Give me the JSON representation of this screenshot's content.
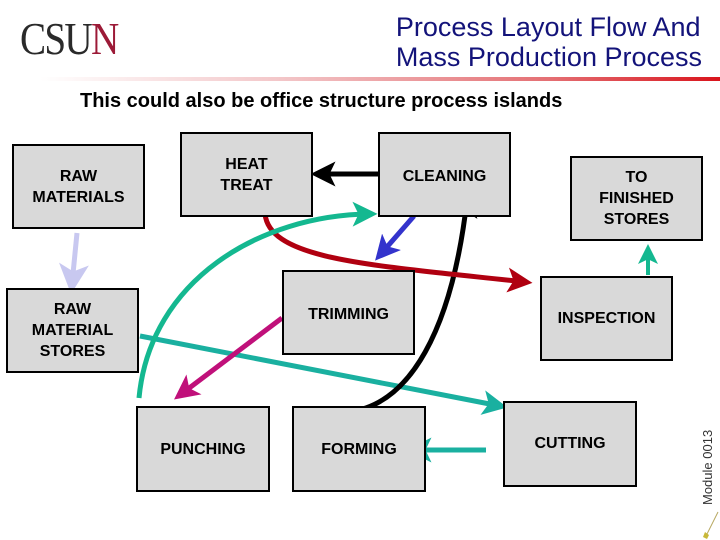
{
  "header": {
    "logo": {
      "primary": "CSU",
      "accent": "N"
    },
    "title_lines": [
      "Process Layout Flow And",
      "Mass Production Process"
    ]
  },
  "subtitle": "This could also be office structure process islands",
  "stations": {
    "raw_materials": {
      "lines": [
        "RAW",
        "MATERIALS"
      ]
    },
    "heat_treat": {
      "lines": [
        "HEAT",
        "TREAT"
      ]
    },
    "cleaning": {
      "lines": [
        "CLEANING"
      ]
    },
    "to_finished_stores": {
      "lines": [
        "TO",
        "FINISHED",
        "STORES"
      ]
    },
    "raw_material_stores": {
      "lines": [
        "RAW",
        "MATERIAL",
        "STORES"
      ]
    },
    "trimming": {
      "lines": [
        "TRIMMING"
      ]
    },
    "inspection": {
      "lines": [
        "INSPECTION"
      ]
    },
    "punching": {
      "lines": [
        "PUNCHING"
      ]
    },
    "forming": {
      "lines": [
        "FORMING"
      ]
    },
    "cutting": {
      "lines": [
        "CUTTING"
      ]
    }
  },
  "flows": [
    {
      "from": "Raw Materials",
      "to": "Raw Material Stores",
      "color": "#c8c8f0"
    },
    {
      "from": "Raw Material Stores",
      "to": "Cutting",
      "color": "#1ab0a0"
    },
    {
      "from": "Cutting",
      "to": "Forming",
      "color": "#1ab0a0"
    },
    {
      "from": "Forming",
      "to": "Cleaning",
      "color": "#000000"
    },
    {
      "from": "Cleaning",
      "to": "Heat Treat",
      "color": "#000000"
    },
    {
      "from": "Heat Treat",
      "to": "Inspection",
      "color": "#b00010"
    },
    {
      "from": "Cleaning",
      "to": "Trimming",
      "color": "#3333cc"
    },
    {
      "from": "Trimming",
      "to": "Punching",
      "color": "#c0107a"
    },
    {
      "from": "Punching",
      "to": "Cleaning",
      "color": "#14b890"
    },
    {
      "from": "Inspection",
      "to": "To Finished Stores",
      "color": "#14b890"
    }
  ],
  "footer": {
    "module_label": "Module 0013"
  }
}
